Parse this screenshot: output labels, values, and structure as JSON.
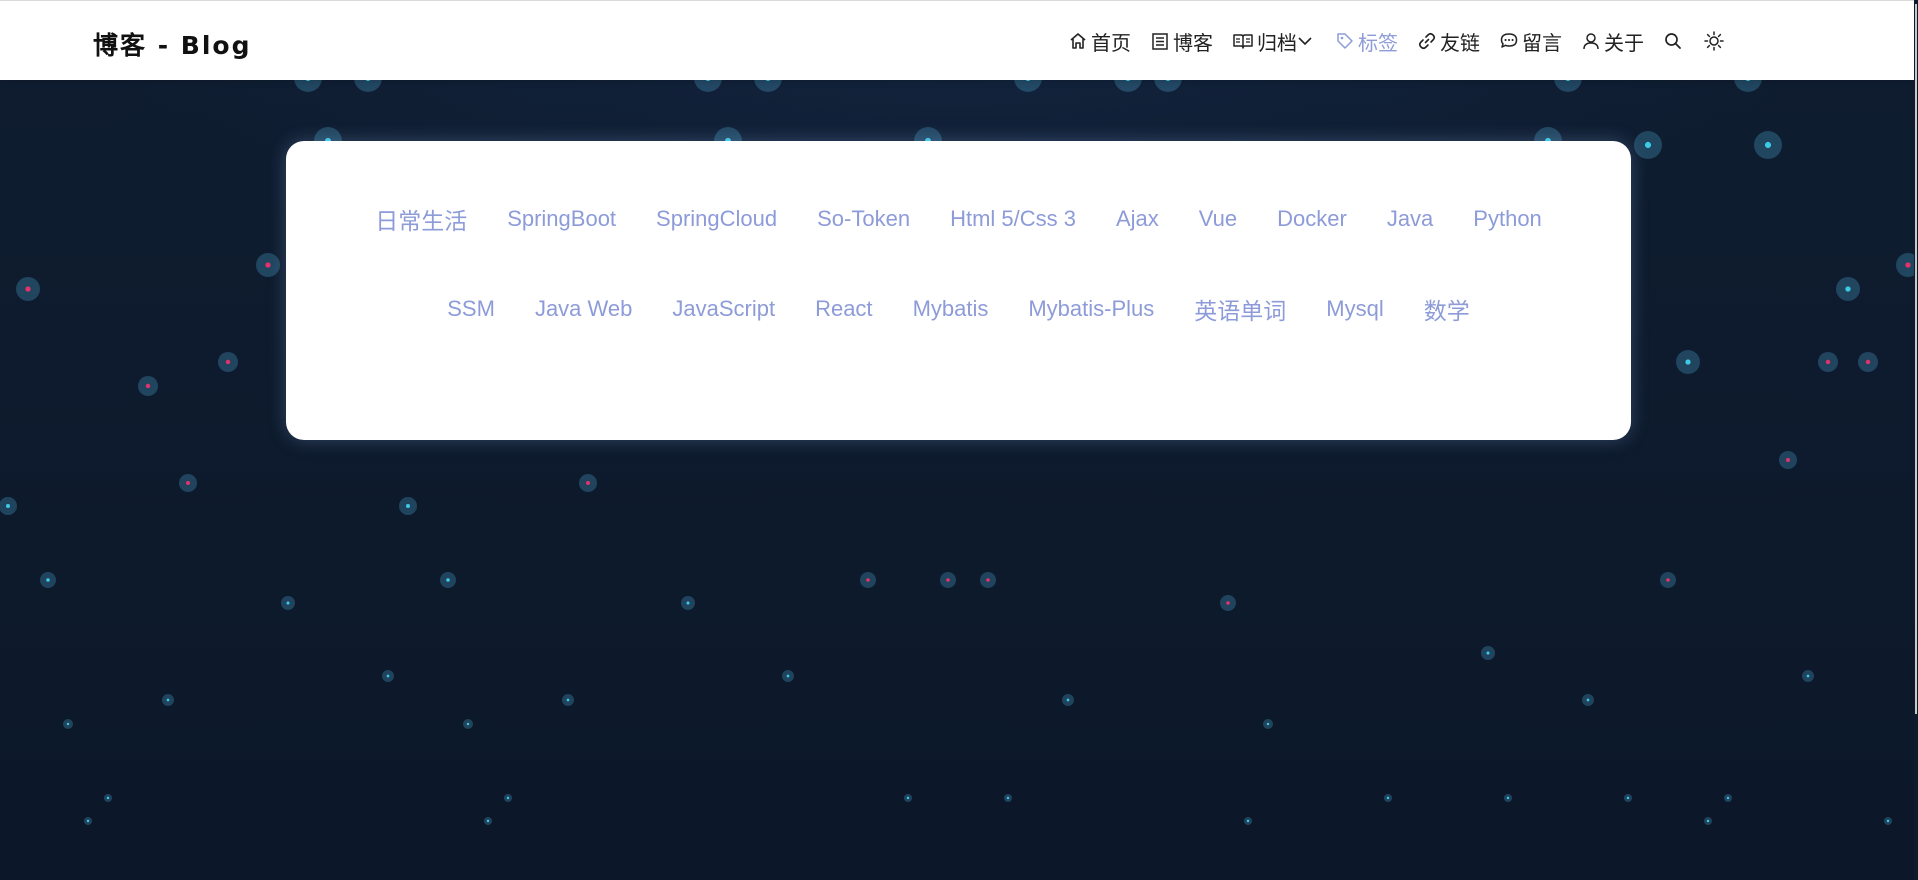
{
  "brand": "博客 - Blog",
  "nav": [
    {
      "label": "首页",
      "icon": "home-icon"
    },
    {
      "label": "博客",
      "icon": "list-icon"
    },
    {
      "label": "归档",
      "icon": "book-icon"
    },
    {
      "label": "标签",
      "icon": "tag-icon",
      "active": true
    },
    {
      "label": "友链",
      "icon": "link-icon"
    },
    {
      "label": "留言",
      "icon": "message-icon"
    },
    {
      "label": "关于",
      "icon": "user-icon"
    }
  ],
  "tools": [
    "search-icon",
    "theme-sun-icon"
  ],
  "tags_row1": [
    "日常生活",
    "SpringBoot",
    "SpringCloud",
    "So-Token",
    "Html 5/Css 3",
    "Ajax",
    "Vue",
    "Docker",
    "Java",
    "Python"
  ],
  "tags_row2": [
    "SSM",
    "Java Web",
    "JavaScript",
    "React",
    "Mybatis",
    "Mybatis-Plus",
    "英语单词",
    "Mysql",
    "数学"
  ],
  "colors": {
    "background": "#0e1b2d",
    "accent": "#8d9bd9",
    "dot_pink": "#e5326b",
    "dot_cyan": "#3ccbe6"
  }
}
